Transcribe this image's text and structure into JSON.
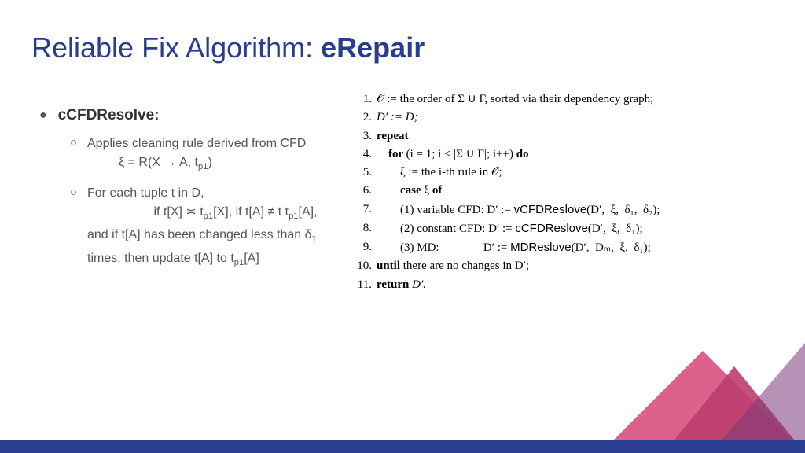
{
  "title": {
    "prefix": "Reliable Fix Algorithm: ",
    "emph": "eRepair"
  },
  "left": {
    "h": "cCFDResolve:",
    "b1a": "Applies cleaning rule derived from CFD",
    "b1b": "ξ = R(X → A, t",
    "b1c": ")",
    "b2a": "For each tuple t in D,",
    "b2b": "if t[X] ≍ t",
    "b2c": "[X], if t[A] ≠ t",
    "b2d": "[A], and if t[A] has been changed less than δ",
    "b2e": " times, then update t[A] to t",
    "b2f": "[A]",
    "p1": "p1",
    "one": "1"
  },
  "algo": {
    "l1": "𝒪 := the order of Σ ∪ Γ, sorted via their dependency graph;",
    "l2": "D′ := D;",
    "l3": "repeat",
    "l4a": "    for ",
    "l4b": "(i = 1; i ≤ |Σ ∪ Γ|; i++) ",
    "l4c": "do",
    "l5": "        ξ := the i-th rule in 𝒪;",
    "l6a": "        case ",
    "l6b": "ξ ",
    "l6c": "of",
    "l7a": "        (1) variable CFD: D′ := ",
    "l7b": "vCFDReslove",
    "l7c": "(D′,  ξ,  δ₁,  δ₂);",
    "l8a": "        (2) constant CFD: D′ := ",
    "l8b": "cCFDReslove",
    "l8c": "(D′,  ξ,  δ₁);",
    "l9a": "        (3) MD:               D′ := ",
    "l9b": "MDReslove",
    "l9c": "(D′,  Dₘ,  ξ,  δ₁);",
    "l10a": "until ",
    "l10b": "there are no changes in D′;",
    "l11a": "return ",
    "l11b": "D′."
  }
}
